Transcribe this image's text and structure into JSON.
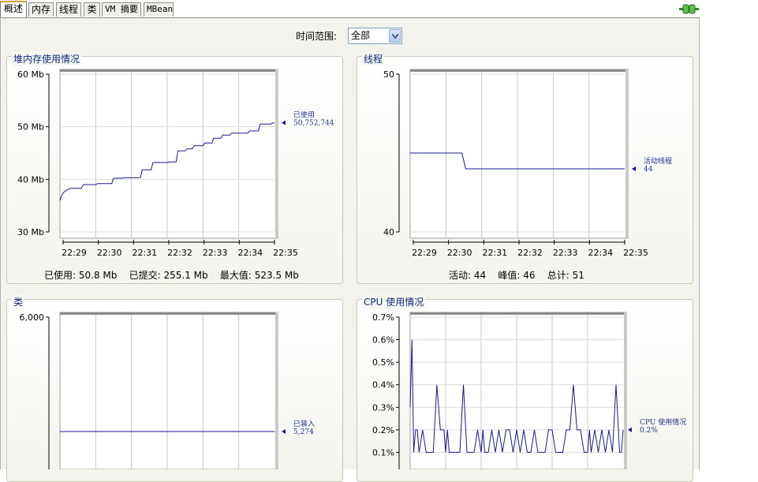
{
  "tabs": [
    {
      "label": "概述",
      "active": true
    },
    {
      "label": "内存",
      "active": false
    },
    {
      "label": "线程",
      "active": false
    },
    {
      "label": "类",
      "active": false
    },
    {
      "label": "VM 摘要",
      "active": false
    },
    {
      "label": "MBean",
      "active": false
    }
  ],
  "time_range": {
    "label": "时间范围:",
    "value": "全部"
  },
  "colors": {
    "series": "#1a1a8c",
    "panel_title": "#0f2a7a"
  },
  "panels": {
    "heap": {
      "title": "堆内存使用情况",
      "stats": "已使用: 50.8 Mb    已提交: 255.1 Mb    最大值: 523.5 Mb"
    },
    "threads": {
      "title": "线程",
      "stats": "活动: 44    峰值: 46    总计: 51"
    },
    "classes": {
      "title": "类"
    },
    "cpu": {
      "title": "CPU 使用情况"
    }
  },
  "chart_data": [
    {
      "id": "heap",
      "type": "line",
      "ylabel_ticks": [
        "30 Mb",
        "40 Mb",
        "50 Mb",
        "60 Mb"
      ],
      "ylim": [
        30,
        60
      ],
      "yticks": [
        30,
        40,
        50,
        60
      ],
      "xticks": [
        "22:29",
        "22:30",
        "22:31",
        "22:32",
        "22:33",
        "22:34",
        "22:35"
      ],
      "xlim": [
        0,
        6
      ],
      "series": [
        {
          "name": "已使用",
          "last_label": "50,752,744",
          "x": [
            0,
            0.05,
            0.1,
            0.2,
            0.3,
            0.6,
            0.65,
            1.0,
            1.05,
            1.45,
            1.5,
            1.75,
            1.8,
            2.25,
            2.3,
            2.55,
            2.6,
            3.0,
            3.05,
            3.25,
            3.3,
            3.5,
            3.55,
            3.7,
            3.75,
            4.0,
            4.05,
            4.25,
            4.3,
            4.5,
            4.55,
            4.75,
            4.8,
            5.25,
            5.3,
            5.55,
            5.6,
            5.9,
            5.95,
            6.0
          ],
          "y": [
            36,
            37,
            37.5,
            38,
            38.3,
            38.3,
            39,
            39,
            39.2,
            39.2,
            40.2,
            40.2,
            40.3,
            40.3,
            41.8,
            41.8,
            43.2,
            43.2,
            43.3,
            43.3,
            45.4,
            45.4,
            45.8,
            45.8,
            46.4,
            46.4,
            46.9,
            46.9,
            47.8,
            47.8,
            48.4,
            48.4,
            48.8,
            48.8,
            49.2,
            49.2,
            50.5,
            50.5,
            50.75,
            50.75
          ]
        }
      ]
    },
    {
      "id": "threads",
      "type": "line",
      "ylabel_ticks": [
        "40",
        "50"
      ],
      "ylim": [
        40,
        50
      ],
      "yticks": [
        40,
        50
      ],
      "xticks": [
        "22:29",
        "22:30",
        "22:31",
        "22:32",
        "22:33",
        "22:34",
        "22:35"
      ],
      "xlim": [
        0,
        6
      ],
      "series": [
        {
          "name": "活动线程",
          "last_label": "44",
          "x": [
            0,
            1.45,
            1.55,
            6.0
          ],
          "y": [
            45,
            45,
            44,
            44
          ]
        }
      ]
    },
    {
      "id": "classes",
      "type": "line",
      "ylabel_ticks": [
        "6,000"
      ],
      "ylim": [
        0,
        6000
      ],
      "yticks": [
        6000
      ],
      "xticks": [],
      "xlim": [
        0,
        6
      ],
      "series": [
        {
          "name": "已装入",
          "last_label": "5,274",
          "x": [
            0,
            6.0
          ],
          "y": [
            5274,
            5274
          ]
        }
      ]
    },
    {
      "id": "cpu",
      "type": "line",
      "ylabel_ticks": [
        "0.1%",
        "0.2%",
        "0.3%",
        "0.4%",
        "0.5%",
        "0.6%",
        "0.7%"
      ],
      "ylim": [
        0,
        0.7
      ],
      "yticks": [
        0.1,
        0.2,
        0.3,
        0.4,
        0.5,
        0.6,
        0.7
      ],
      "xticks": [],
      "xlim": [
        0,
        6
      ],
      "series": [
        {
          "name": "CPU 使用情况",
          "last_label": "0.2%",
          "x": [
            0,
            0.05,
            0.1,
            0.15,
            0.2,
            0.25,
            0.35,
            0.45,
            0.55,
            0.65,
            0.75,
            0.85,
            0.95,
            1.0,
            1.05,
            1.1,
            1.2,
            1.3,
            1.4,
            1.5,
            1.6,
            1.7,
            1.8,
            1.9,
            2.0,
            2.05,
            2.1,
            2.2,
            2.3,
            2.4,
            2.5,
            2.6,
            2.7,
            2.8,
            2.9,
            3.0,
            3.1,
            3.2,
            3.3,
            3.4,
            3.5,
            3.6,
            3.7,
            3.8,
            3.9,
            4.0,
            4.1,
            4.2,
            4.3,
            4.4,
            4.5,
            4.6,
            4.7,
            4.8,
            4.9,
            5.0,
            5.05,
            5.1,
            5.2,
            5.3,
            5.4,
            5.5,
            5.6,
            5.7,
            5.8,
            5.9,
            5.95,
            6.0
          ],
          "y": [
            0.3,
            0.6,
            0.1,
            0.2,
            0.2,
            0.1,
            0.2,
            0.1,
            0.1,
            0.1,
            0.4,
            0.2,
            0.2,
            0.1,
            0.2,
            0.1,
            0.1,
            0.1,
            0.1,
            0.4,
            0.1,
            0.1,
            0.1,
            0.2,
            0.1,
            0.2,
            0.1,
            0.1,
            0.2,
            0.1,
            0.2,
            0.1,
            0.2,
            0.2,
            0.1,
            0.2,
            0.1,
            0.2,
            0.1,
            0.1,
            0.2,
            0.1,
            0.1,
            0.1,
            0.2,
            0.2,
            0.1,
            0.1,
            0.1,
            0.2,
            0.2,
            0.4,
            0.2,
            0.2,
            0.1,
            0.1,
            0.2,
            0.1,
            0.2,
            0.1,
            0.2,
            0.1,
            0.2,
            0.1,
            0.4,
            0.1,
            0.1,
            0.2
          ]
        }
      ]
    }
  ]
}
